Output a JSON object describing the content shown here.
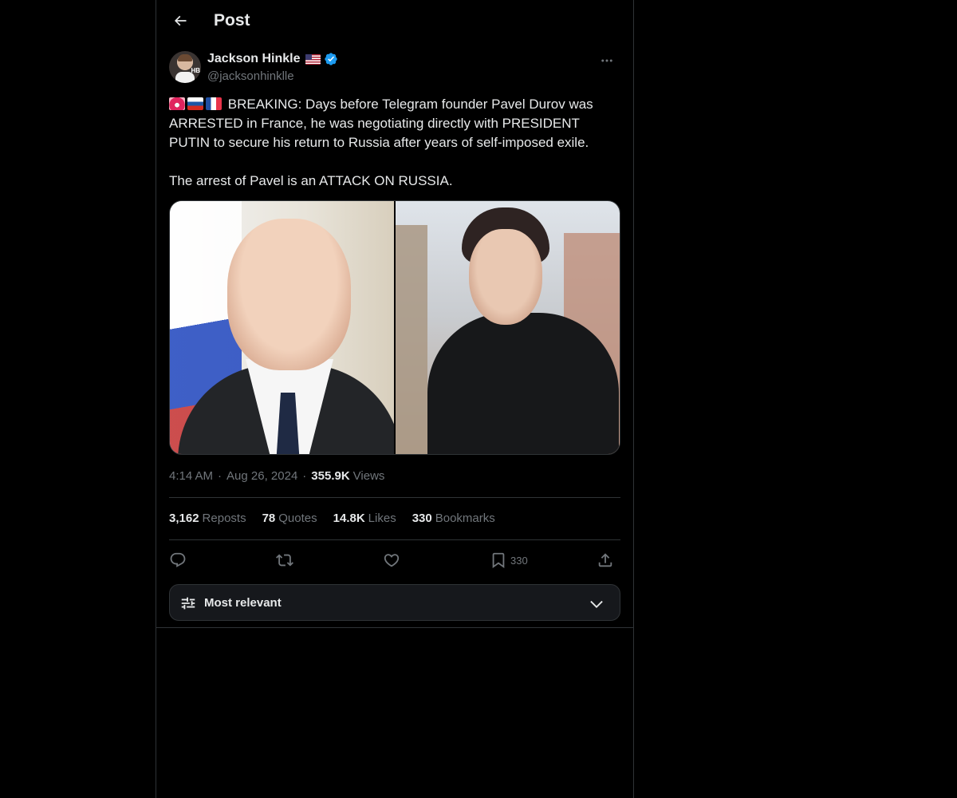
{
  "header": {
    "title": "Post",
    "back_icon": "arrow-left-icon"
  },
  "author": {
    "display_name": "Jackson Hinkle",
    "handle": "@jacksonhinklle",
    "avatar_badge": "HB",
    "flag_icon": "us-flag-icon",
    "verified_icon": "verified-badge-icon",
    "more_icon": "more-horizontal-icon"
  },
  "post": {
    "emojis": [
      "siren-emoji",
      "russia-flag-emoji",
      "france-flag-emoji"
    ],
    "line1": "BREAKING: Days before Telegram founder Pavel Durov was ARRESTED in France, he was negotiating directly with PRESIDENT PUTIN to secure his return to Russia after years of self-imposed exile.",
    "line2": "The arrest of Pavel is an ATTACK ON RUSSIA.",
    "media": [
      "photo-putin",
      "photo-durov"
    ]
  },
  "meta": {
    "time": "4:14 AM",
    "sep1": "·",
    "date": "Aug 26, 2024",
    "sep2": "·",
    "views_count": "355.9K",
    "views_label": "Views"
  },
  "stats": {
    "reposts_count": "3,162",
    "reposts_label": "Reposts",
    "quotes_count": "78",
    "quotes_label": "Quotes",
    "likes_count": "14.8K",
    "likes_label": "Likes",
    "bookmarks_count": "330",
    "bookmarks_label": "Bookmarks"
  },
  "actions": {
    "bookmark_count": "330"
  },
  "sort": {
    "label": "Most relevant"
  },
  "colors": {
    "background": "#000000",
    "text": "#e7e9ea",
    "muted": "#71767b",
    "border": "#2f3336",
    "verified": "#1d9bf0"
  }
}
